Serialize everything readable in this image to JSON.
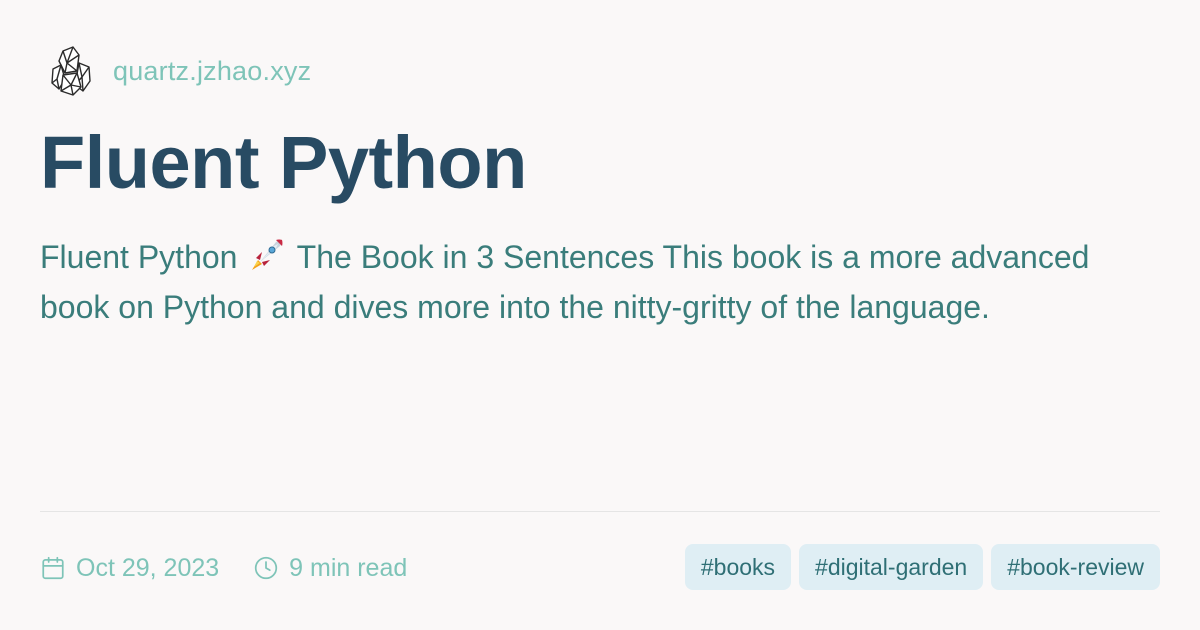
{
  "site": {
    "domain": "quartz.jzhao.xyz",
    "logo_icon": "crystal-icon"
  },
  "page": {
    "title": "Fluent Python",
    "description_before_icon": "Fluent Python",
    "description_icon": "rocket-icon",
    "description_after_icon": "The Book in 3 Sentences This book is a more advanced book on Python and dives more into the nitty-gritty of the language."
  },
  "meta": {
    "date": "Oct 29, 2023",
    "date_icon": "calendar-icon",
    "read_time": "9 min read",
    "read_time_icon": "clock-icon"
  },
  "tags": [
    "#books",
    "#digital-garden",
    "#book-review"
  ],
  "colors": {
    "background": "#faf8f8",
    "title": "#284b63",
    "description": "#3a7d7b",
    "secondary": "#7ec4b8",
    "tag_background": "#dfeef4",
    "tag_text": "#2f6f75"
  }
}
